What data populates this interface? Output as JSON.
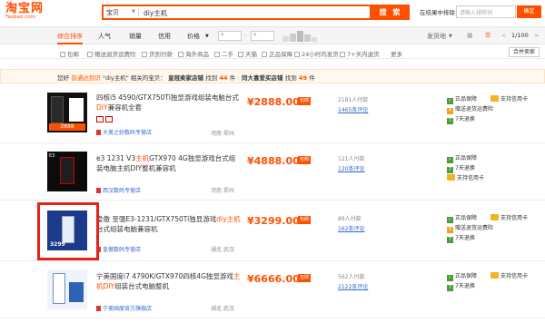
{
  "header": {
    "logo_main": "淘宝网",
    "logo_sub": "Taobao.com",
    "search_category": "宝贝",
    "search_query": "diy主机",
    "search_button": "搜 索",
    "in_results_label": "在结果中排除",
    "in_results_placeholder": "请输入排除词",
    "in_results_confirm": "确定"
  },
  "sortbar": {
    "items": [
      "综合排序",
      "人气",
      "销量",
      "信用",
      "价格"
    ],
    "price_from": "¥",
    "price_to": "¥",
    "ship_from": "发货地",
    "pager": "1/100"
  },
  "filters": {
    "items": [
      "包邮",
      "赠送退货运费险",
      "货到付款",
      "海外商品",
      "二手",
      "天猫",
      "正品保障",
      "24小时内发货",
      "7+天内退货"
    ],
    "more": "更多",
    "merge_button": "合并卖家"
  },
  "notice": {
    "prefix": "您好",
    "link": "普通达到识",
    "text_1": "\"diy主机\" 相关的宝贝：",
    "gold_label": "皇冠卖家店铺",
    "gold_text": "找到",
    "gold_count": "44",
    "gold_unit": "件",
    "sep": "|",
    "crown_label": "同大喜爱买店铺",
    "crown_text": "找到",
    "crown_count": "49",
    "crown_unit": "件"
  },
  "products": [
    {
      "title_pre": "四核i5 4590/GTX750Ti独显游戏组装电脑台式",
      "title_hl": "DIY",
      "title_post": "兼容机全套",
      "price": "¥2888.00",
      "cod": "包邮",
      "sales": "2181人付款",
      "reviews": "1465条评论",
      "shop": "大美之妙数码专营店",
      "location": "河南 郑州",
      "services": [
        "正品保障",
        "赠送退货运费险",
        "7天退换"
      ],
      "pay": "支持信用卡",
      "thumb_text": "2888"
    },
    {
      "title_pre": "e3 1231 V3",
      "title_hl": "主机",
      "title_post": "GTX970 4G独显游戏台式组装电脑主机DIY整机兼容机",
      "price": "¥4888.00",
      "cod": "包邮",
      "sales": "121人付款",
      "reviews": "120条评论",
      "shop": "西汉数码专营店",
      "location": "河南 郑州",
      "services": [
        "正品保障",
        "7天退换",
        "支持信用卡"
      ],
      "pay": "",
      "thumb_text": "E3"
    },
    {
      "title_pre": "皇傲 至强E3-1231/GTX750Ti独显游戏",
      "title_hl": "diy主机",
      "title_post": "台式组装电脑兼容机",
      "price": "¥3299.00",
      "cod": "包邮",
      "sales": "89人付款",
      "reviews": "162条评论",
      "shop": "皇傲数码专营店",
      "location": "湖北 武汉",
      "services": [
        "正品保障",
        "赠送退货运费险",
        "7天退换"
      ],
      "pay": "支持信用卡",
      "thumb_text": "3299"
    },
    {
      "title_pre": "宁美国度i7 4790K/GTX970四核4G独显游戏",
      "title_hl": "主机DIY",
      "title_post": "组装台式电脑整机",
      "price": "¥6666.00",
      "cod": "包邮",
      "sales": "562人付款",
      "reviews": "2122条评论",
      "shop": "宁美国度官方旗舰店",
      "location": "湖北 武汉",
      "services": [
        "正品保障",
        "7天退换"
      ],
      "pay": "支持信用卡",
      "thumb_text": ""
    }
  ]
}
